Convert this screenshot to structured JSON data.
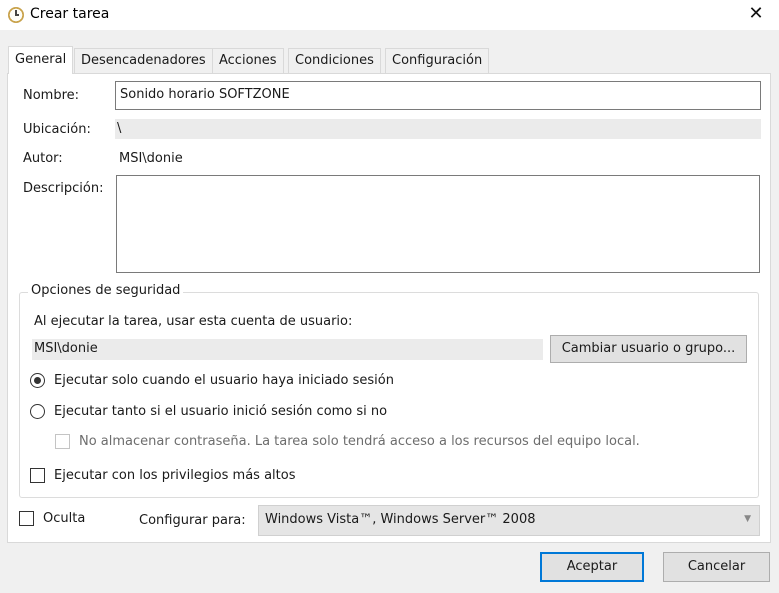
{
  "window": {
    "title": "Crear tarea",
    "close_glyph": "✕"
  },
  "tabs": [
    {
      "label": "General",
      "active": true
    },
    {
      "label": "Desencadenadores",
      "active": false
    },
    {
      "label": "Acciones",
      "active": false
    },
    {
      "label": "Condiciones",
      "active": false
    },
    {
      "label": "Configuración",
      "active": false
    }
  ],
  "general": {
    "name_label": "Nombre:",
    "name_value": "Sonido horario SOFTZONE",
    "location_label": "Ubicación:",
    "location_value": "\\",
    "author_label": "Autor:",
    "author_value": "MSI\\donie",
    "description_label": "Descripción:",
    "description_value": ""
  },
  "security": {
    "group_title": "Opciones de seguridad",
    "account_prompt": "Al ejecutar la tarea, usar esta cuenta de usuario:",
    "account_value": "MSI\\donie",
    "change_user_button": "Cambiar usuario o grupo...",
    "radio_logged_on": {
      "label": "Ejecutar solo cuando el usuario haya iniciado sesión",
      "checked": true
    },
    "radio_any": {
      "label": "Ejecutar tanto si el usuario inició sesión como si no",
      "checked": false
    },
    "no_store_password": {
      "label": "No almacenar contraseña. La tarea solo tendrá acceso a los recursos del equipo local.",
      "checked": false,
      "disabled": true
    },
    "highest_privileges": {
      "label": "Ejecutar con los privilegios más altos",
      "checked": false
    }
  },
  "footer": {
    "hidden_label": "Oculta",
    "hidden_checked": false,
    "configure_label": "Configurar para:",
    "configure_value": "Windows Vista™, Windows Server™ 2008"
  },
  "buttons": {
    "accept": "Aceptar",
    "cancel": "Cancelar"
  },
  "colors": {
    "accent": "#0078d7",
    "readonly_bg": "#ebebeb",
    "window_bg": "#f0f0f0"
  }
}
